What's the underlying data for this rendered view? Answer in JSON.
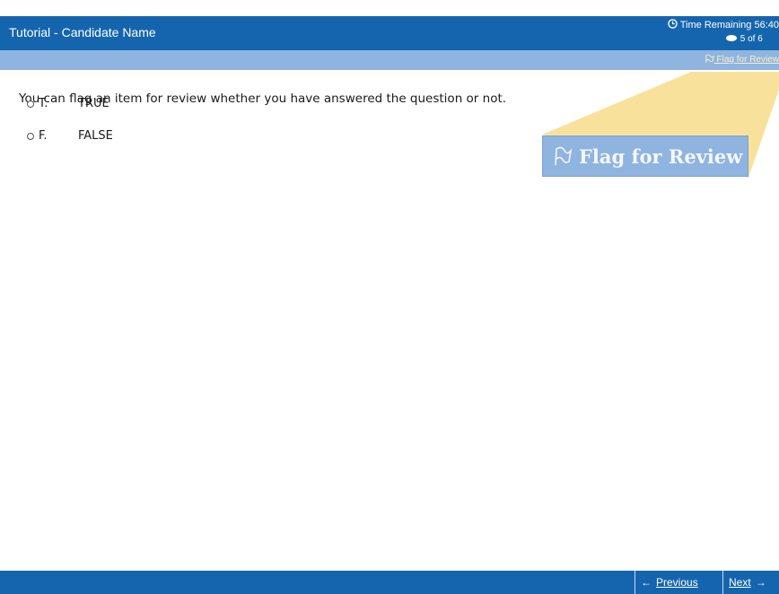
{
  "header": {
    "title": "Tutorial - Candidate Name",
    "time_remaining": "Time Remaining 56:40",
    "question_counter": "5 of 6"
  },
  "toolbar": {
    "flag_label": "Flag for Review"
  },
  "question": {
    "text": "You can flag an item for review whether you have answered the question or not.",
    "options": [
      {
        "letter": "T.",
        "label": "TRUE"
      },
      {
        "letter": "F.",
        "label": "FALSE"
      }
    ]
  },
  "callout": {
    "flag_label": "Flag for Review"
  },
  "footer": {
    "previous_label": "Previous",
    "next_label": "Next"
  },
  "colors": {
    "header_blue": "#1565ae",
    "toolbar_blue": "#8fb4df",
    "callout_beam": "#f7dd8a"
  }
}
